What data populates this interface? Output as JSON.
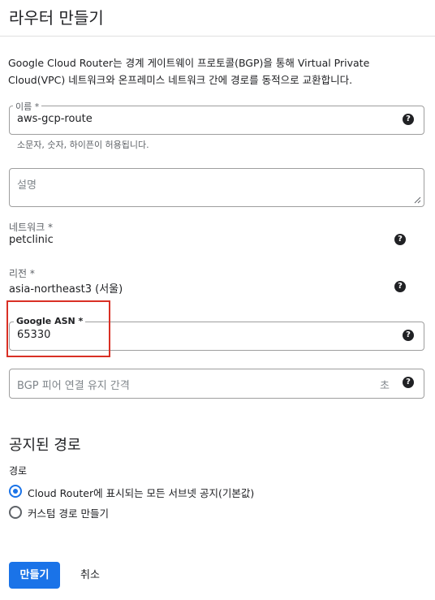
{
  "header": {
    "title": "라우터 만들기"
  },
  "description": "Google Cloud Router는 경계 게이트웨이 프로토콜(BGP)을 통해 Virtual Private Cloud(VPC) 네트워크와 온프레미스 네트워크 간에 경로를 동적으로 교환합니다.",
  "name_field": {
    "label": "이름 *",
    "value": "aws-gcp-route",
    "hint": "소문자, 숫자, 하이픈이 허용됩니다.",
    "help_icon": "help-icon"
  },
  "description_field": {
    "placeholder": "설명"
  },
  "network": {
    "label": "네트워크 *",
    "value": "petclinic",
    "help_icon": "help-icon"
  },
  "region": {
    "label": "리전 *",
    "value": "asia-northeast3 (서울)",
    "help_icon": "help-icon"
  },
  "asn_field": {
    "label": "Google ASN *",
    "value": "65330",
    "help_icon": "help-icon"
  },
  "keepalive_field": {
    "placeholder": "BGP 피어 연결 유지 간격",
    "suffix": "초",
    "help_icon": "help-icon"
  },
  "advertised_routes": {
    "title": "공지된 경로",
    "routes_label": "경로",
    "options": [
      {
        "label": "Cloud Router에 표시되는 모든 서브넷 공지(기본값)",
        "selected": true
      },
      {
        "label": "커스텀 경로 만들기",
        "selected": false
      }
    ]
  },
  "actions": {
    "create": "만들기",
    "cancel": "취소"
  },
  "colors": {
    "accent": "#1a73e8",
    "highlight": "#d93025"
  }
}
